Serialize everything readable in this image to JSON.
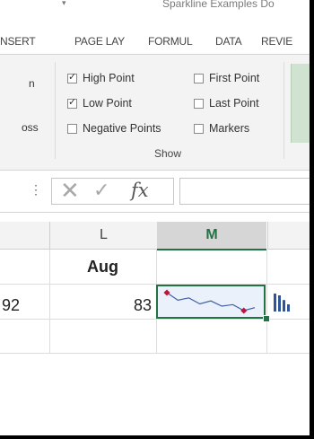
{
  "window": {
    "title": "Sparkline Examples Do",
    "dropdown_glyph": "▾"
  },
  "ribbon_tabs": [
    {
      "label": "NSERT"
    },
    {
      "label": "PAGE LAY"
    },
    {
      "label": "FORMUL"
    },
    {
      "label": "DATA"
    },
    {
      "label": "REVIE"
    }
  ],
  "ribbon": {
    "partial_labels": [
      "n",
      "oss"
    ],
    "show_group": {
      "label": "Show",
      "options": [
        {
          "label": "High Point",
          "checked": true
        },
        {
          "label": "Low Point",
          "checked": true
        },
        {
          "label": "Negative Points",
          "checked": false
        },
        {
          "label": "First Point",
          "checked": false
        },
        {
          "label": "Last Point",
          "checked": false
        },
        {
          "label": "Markers",
          "checked": false
        }
      ]
    }
  },
  "formula_bar": {
    "dots": "⋮",
    "cancel_glyph": "✕",
    "enter_glyph": "✓",
    "fx_label": "fx",
    "value": ""
  },
  "sheet": {
    "columns": [
      {
        "label": "L"
      },
      {
        "label": "M",
        "selected": true
      }
    ],
    "header_cell": "Aug",
    "left_value": "92",
    "aug_value": "83",
    "sparkline": {
      "values": [
        9,
        7,
        7.6,
        6,
        6.8,
        5.4,
        5.8,
        4.2,
        5
      ],
      "line_color": "#3f5fa8",
      "marker_color": "#c0143c"
    },
    "column_sparkline": {
      "values": [
        5,
        4.5,
        3.2,
        2
      ],
      "color": "#2e5597"
    }
  }
}
